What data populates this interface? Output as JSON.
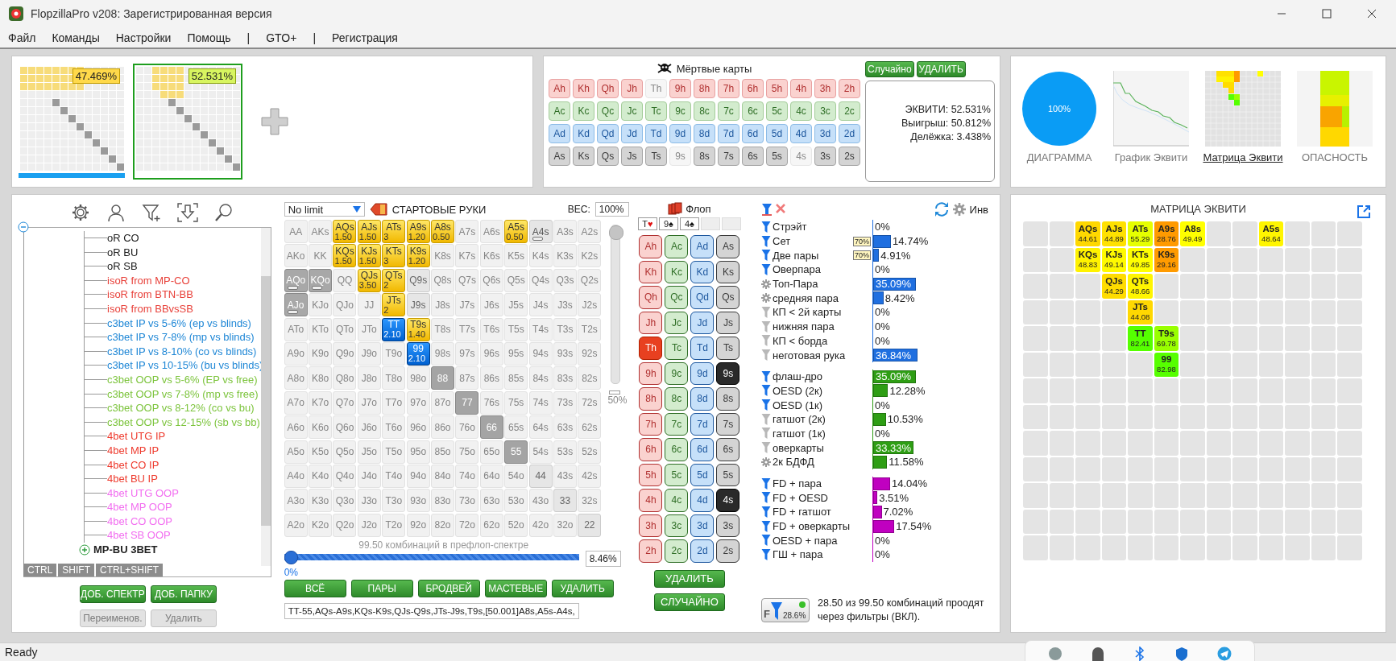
{
  "window": {
    "title": "FlopzillaPro v208: Зарегистрированная версия"
  },
  "menu": [
    "Файл",
    "Команды",
    "Настройки",
    "Помощь",
    "|",
    "GTO+",
    "|",
    "Регистрация"
  ],
  "ranges": [
    {
      "equity": "47.469%",
      "selected": false
    },
    {
      "equity": "52.531%",
      "selected": true
    }
  ],
  "dead_cards": {
    "title": "Мёртвые карты",
    "buttons": [
      "Случайно",
      "УДАЛИТЬ"
    ],
    "rows": [
      {
        "kind": "h",
        "cards": [
          {
            "label": "Ah",
            "used": false
          },
          {
            "label": "Kh",
            "used": false
          },
          {
            "label": "Qh",
            "used": false
          },
          {
            "label": "Jh",
            "used": false
          },
          {
            "label": "Th",
            "used": true
          },
          {
            "label": "9h",
            "used": false
          },
          {
            "label": "8h",
            "used": false
          },
          {
            "label": "7h",
            "used": false
          },
          {
            "label": "6h",
            "used": false
          },
          {
            "label": "5h",
            "used": false
          },
          {
            "label": "4h",
            "used": false
          },
          {
            "label": "3h",
            "used": false
          },
          {
            "label": "2h",
            "used": false
          }
        ]
      },
      {
        "kind": "c",
        "cards": [
          {
            "label": "Ac",
            "used": false
          },
          {
            "label": "Kc",
            "used": false
          },
          {
            "label": "Qc",
            "used": false
          },
          {
            "label": "Jc",
            "used": false
          },
          {
            "label": "Tc",
            "used": false
          },
          {
            "label": "9c",
            "used": false
          },
          {
            "label": "8c",
            "used": false
          },
          {
            "label": "7c",
            "used": false
          },
          {
            "label": "6c",
            "used": false
          },
          {
            "label": "5c",
            "used": false
          },
          {
            "label": "4c",
            "used": false
          },
          {
            "label": "3c",
            "used": false
          },
          {
            "label": "2c",
            "used": false
          }
        ]
      },
      {
        "kind": "d",
        "cards": [
          {
            "label": "Ad",
            "used": false
          },
          {
            "label": "Kd",
            "used": false
          },
          {
            "label": "Qd",
            "used": false
          },
          {
            "label": "Jd",
            "used": false
          },
          {
            "label": "Td",
            "used": false
          },
          {
            "label": "9d",
            "used": false
          },
          {
            "label": "8d",
            "used": false
          },
          {
            "label": "7d",
            "used": false
          },
          {
            "label": "6d",
            "used": false
          },
          {
            "label": "5d",
            "used": false
          },
          {
            "label": "4d",
            "used": false
          },
          {
            "label": "3d",
            "used": false
          },
          {
            "label": "2d",
            "used": false
          }
        ]
      },
      {
        "kind": "s",
        "cards": [
          {
            "label": "As",
            "used": false
          },
          {
            "label": "Ks",
            "used": false
          },
          {
            "label": "Qs",
            "used": false
          },
          {
            "label": "Js",
            "used": false
          },
          {
            "label": "Ts",
            "used": false
          },
          {
            "label": "9s",
            "used": true
          },
          {
            "label": "8s",
            "used": false
          },
          {
            "label": "7s",
            "used": false
          },
          {
            "label": "6s",
            "used": false
          },
          {
            "label": "5s",
            "used": false
          },
          {
            "label": "4s",
            "used": true
          },
          {
            "label": "3s",
            "used": false
          },
          {
            "label": "2s",
            "used": false
          }
        ]
      }
    ],
    "stats": [
      "ЭКВИТИ: 52.531%",
      "Выигрыш: 50.812%",
      "Делёжка: 3.438%"
    ]
  },
  "views": {
    "pie_label": "100%",
    "tabs": [
      {
        "label": "ДИАГРАММА",
        "kind": "pie",
        "selected": false
      },
      {
        "label": "График Эквити",
        "kind": "line",
        "selected": false
      },
      {
        "label": "Матрица Эквити",
        "kind": "matrix",
        "selected": true
      },
      {
        "label": "ОПАСНОСТЬ",
        "kind": "danger",
        "selected": false
      }
    ]
  },
  "tree": {
    "expanded": true,
    "children": [
      {
        "children": [
          {
            "label": "oR CO",
            "color": "#1a1a1a"
          },
          {
            "label": "oR BU",
            "color": "#1a1a1a"
          },
          {
            "label": "oR SB",
            "color": "#1a1a1a"
          },
          {
            "label": "isoR from MP-CO",
            "color": "#e8413a"
          },
          {
            "label": "isoR from BTN-BB",
            "color": "#e8413a"
          },
          {
            "label": "isoR from BBvsSB",
            "color": "#e8413a"
          },
          {
            "label": "c3bet IP vs 5-6% (ep vs blinds)",
            "color": "#1f87d6"
          },
          {
            "label": "c3bet IP vs 7-8% (mp vs blinds)",
            "color": "#1f87d6"
          },
          {
            "label": "c3bet IP vs 8-10% (co vs blinds)",
            "color": "#1f87d6"
          },
          {
            "label": "c3bet IP vs 10-15% (bu vs blinds)",
            "color": "#1f87d6"
          },
          {
            "label": "c3bet OOP vs 5-6% (EP vs free)",
            "color": "#7cc43c"
          },
          {
            "label": "c3bet OOP vs 7-8% (mp vs free)",
            "color": "#7cc43c"
          },
          {
            "label": "c3bet OOP vs 8-12% (co vs bu)",
            "color": "#7cc43c"
          },
          {
            "label": "c3bet OOP vs 12-15% (sb vs bb)",
            "color": "#7cc43c"
          },
          {
            "label": "4bet UTG IP",
            "color": "#ee3b2e"
          },
          {
            "label": "4bet MP IP",
            "color": "#ee3b2e"
          },
          {
            "label": "4bet CO IP",
            "color": "#ee3b2e"
          },
          {
            "label": "4bet BU IP",
            "color": "#ee3b2e"
          },
          {
            "label": "4bet UTG OOP",
            "color": "#f26ef0"
          },
          {
            "label": "4bet MP OOP",
            "color": "#f26ef0"
          },
          {
            "label": "4bet CO OOP",
            "color": "#f26ef0"
          },
          {
            "label": "4bet SB OOP",
            "color": "#f26ef0"
          }
        ]
      },
      {
        "label": "MP-BU 3BET",
        "expanded": false
      }
    ]
  },
  "modifier_keys": [
    "CTRL",
    "SHIFT",
    "CTRL+SHIFT"
  ],
  "tree_buttons": [
    {
      "label": "ДОБ. СПЕКТР",
      "disabled": false
    },
    {
      "label": "ДОБ. ПАПКУ",
      "disabled": false
    },
    {
      "label": "Переименов.",
      "disabled": true
    },
    {
      "label": "Удалить",
      "disabled": true
    }
  ],
  "game": "No limit",
  "hands_title": "СТАРТОВЫЕ РУКИ",
  "weight_label": "ВЕС:",
  "weight_value": "100%",
  "weight_slider": {
    "level": 1,
    "label": "50%"
  },
  "hand_matrix": [
    [
      {
        "label": "AA",
        "kind": "off"
      },
      {
        "label": "AKs",
        "kind": "off"
      },
      {
        "label": "AQs",
        "kind": "on",
        "weight": "1.50"
      },
      {
        "label": "AJs",
        "kind": "on",
        "weight": "1.50"
      },
      {
        "label": "ATs",
        "kind": "on",
        "weight": "3"
      },
      {
        "label": "A9s",
        "kind": "on",
        "weight": "1.20"
      },
      {
        "label": "A8s",
        "kind": "on",
        "weight": "0.50"
      },
      {
        "label": "A7s",
        "kind": "off"
      },
      {
        "label": "A6s",
        "kind": "off"
      },
      {
        "label": "A5s",
        "kind": "on",
        "weight": "0.50"
      },
      {
        "label": "A4s",
        "kind": "palepart"
      },
      {
        "label": "A3s",
        "kind": "off"
      },
      {
        "label": "A2s",
        "kind": "off"
      }
    ],
    [
      {
        "label": "AKo",
        "kind": "off"
      },
      {
        "label": "KK",
        "kind": "off"
      },
      {
        "label": "KQs",
        "kind": "on",
        "weight": "1.50"
      },
      {
        "label": "KJs",
        "kind": "on",
        "weight": "1.50"
      },
      {
        "label": "KTs",
        "kind": "on",
        "weight": "3"
      },
      {
        "label": "K9s",
        "kind": "on",
        "weight": "1.20"
      },
      {
        "label": "K8s",
        "kind": "off"
      },
      {
        "label": "K7s",
        "kind": "off"
      },
      {
        "label": "K6s",
        "kind": "off"
      },
      {
        "label": "K5s",
        "kind": "off"
      },
      {
        "label": "K4s",
        "kind": "off"
      },
      {
        "label": "K3s",
        "kind": "off"
      },
      {
        "label": "K2s",
        "kind": "off"
      }
    ],
    [
      {
        "label": "AQo",
        "kind": "part"
      },
      {
        "label": "KQo",
        "kind": "part"
      },
      {
        "label": "QQ",
        "kind": "off"
      },
      {
        "label": "QJs",
        "kind": "on",
        "weight": "3.50"
      },
      {
        "label": "QTs",
        "kind": "on",
        "weight": "2"
      },
      {
        "label": "Q9s",
        "kind": "pale"
      },
      {
        "label": "Q8s",
        "kind": "off"
      },
      {
        "label": "Q7s",
        "kind": "off"
      },
      {
        "label": "Q6s",
        "kind": "off"
      },
      {
        "label": "Q5s",
        "kind": "off"
      },
      {
        "label": "Q4s",
        "kind": "off"
      },
      {
        "label": "Q3s",
        "kind": "off"
      },
      {
        "label": "Q2s",
        "kind": "off"
      }
    ],
    [
      {
        "label": "AJo",
        "kind": "part"
      },
      {
        "label": "KJo",
        "kind": "off"
      },
      {
        "label": "QJo",
        "kind": "off"
      },
      {
        "label": "JJ",
        "kind": "off"
      },
      {
        "label": "JTs",
        "kind": "on",
        "weight": "2"
      },
      {
        "label": "J9s",
        "kind": "pale"
      },
      {
        "label": "J8s",
        "kind": "off"
      },
      {
        "label": "J7s",
        "kind": "off"
      },
      {
        "label": "J6s",
        "kind": "off"
      },
      {
        "label": "J5s",
        "kind": "off"
      },
      {
        "label": "J4s",
        "kind": "off"
      },
      {
        "label": "J3s",
        "kind": "off"
      },
      {
        "label": "J2s",
        "kind": "off"
      }
    ],
    [
      {
        "label": "ATo",
        "kind": "off"
      },
      {
        "label": "KTo",
        "kind": "off"
      },
      {
        "label": "QTo",
        "kind": "off"
      },
      {
        "label": "JTo",
        "kind": "off"
      },
      {
        "label": "TT",
        "kind": "blue",
        "weight": "2.10"
      },
      {
        "label": "T9s",
        "kind": "on",
        "weight": "1.40"
      },
      {
        "label": "T8s",
        "kind": "off"
      },
      {
        "label": "T7s",
        "kind": "off"
      },
      {
        "label": "T6s",
        "kind": "off"
      },
      {
        "label": "T5s",
        "kind": "off"
      },
      {
        "label": "T4s",
        "kind": "off"
      },
      {
        "label": "T3s",
        "kind": "off"
      },
      {
        "label": "T2s",
        "kind": "off"
      }
    ],
    [
      {
        "label": "A9o",
        "kind": "off"
      },
      {
        "label": "K9o",
        "kind": "off"
      },
      {
        "label": "Q9o",
        "kind": "off"
      },
      {
        "label": "J9o",
        "kind": "off"
      },
      {
        "label": "T9o",
        "kind": "off"
      },
      {
        "label": "99",
        "kind": "blue",
        "weight": "2.10"
      },
      {
        "label": "98s",
        "kind": "off"
      },
      {
        "label": "97s",
        "kind": "off"
      },
      {
        "label": "96s",
        "kind": "off"
      },
      {
        "label": "95s",
        "kind": "off"
      },
      {
        "label": "94s",
        "kind": "off"
      },
      {
        "label": "93s",
        "kind": "off"
      },
      {
        "label": "92s",
        "kind": "off"
      }
    ],
    [
      {
        "label": "A8o",
        "kind": "off"
      },
      {
        "label": "K8o",
        "kind": "off"
      },
      {
        "label": "Q8o",
        "kind": "off"
      },
      {
        "label": "J8o",
        "kind": "off"
      },
      {
        "label": "T8o",
        "kind": "off"
      },
      {
        "label": "98o",
        "kind": "off"
      },
      {
        "label": "88",
        "kind": "grey"
      },
      {
        "label": "87s",
        "kind": "off"
      },
      {
        "label": "86s",
        "kind": "off"
      },
      {
        "label": "85s",
        "kind": "off"
      },
      {
        "label": "84s",
        "kind": "off"
      },
      {
        "label": "83s",
        "kind": "off"
      },
      {
        "label": "82s",
        "kind": "off"
      }
    ],
    [
      {
        "label": "A7o",
        "kind": "off"
      },
      {
        "label": "K7o",
        "kind": "off"
      },
      {
        "label": "Q7o",
        "kind": "off"
      },
      {
        "label": "J7o",
        "kind": "off"
      },
      {
        "label": "T7o",
        "kind": "off"
      },
      {
        "label": "97o",
        "kind": "off"
      },
      {
        "label": "87o",
        "kind": "off"
      },
      {
        "label": "77",
        "kind": "grey"
      },
      {
        "label": "76s",
        "kind": "off"
      },
      {
        "label": "75s",
        "kind": "off"
      },
      {
        "label": "74s",
        "kind": "off"
      },
      {
        "label": "73s",
        "kind": "off"
      },
      {
        "label": "72s",
        "kind": "off"
      }
    ],
    [
      {
        "label": "A6o",
        "kind": "off"
      },
      {
        "label": "K6o",
        "kind": "off"
      },
      {
        "label": "Q6o",
        "kind": "off"
      },
      {
        "label": "J6o",
        "kind": "off"
      },
      {
        "label": "T6o",
        "kind": "off"
      },
      {
        "label": "96o",
        "kind": "off"
      },
      {
        "label": "86o",
        "kind": "off"
      },
      {
        "label": "76o",
        "kind": "off"
      },
      {
        "label": "66",
        "kind": "grey"
      },
      {
        "label": "65s",
        "kind": "off"
      },
      {
        "label": "64s",
        "kind": "off"
      },
      {
        "label": "63s",
        "kind": "off"
      },
      {
        "label": "62s",
        "kind": "off"
      }
    ],
    [
      {
        "label": "A5o",
        "kind": "off"
      },
      {
        "label": "K5o",
        "kind": "off"
      },
      {
        "label": "Q5o",
        "kind": "off"
      },
      {
        "label": "J5o",
        "kind": "off"
      },
      {
        "label": "T5o",
        "kind": "off"
      },
      {
        "label": "95o",
        "kind": "off"
      },
      {
        "label": "85o",
        "kind": "off"
      },
      {
        "label": "75o",
        "kind": "off"
      },
      {
        "label": "65o",
        "kind": "off"
      },
      {
        "label": "55",
        "kind": "grey"
      },
      {
        "label": "54s",
        "kind": "off"
      },
      {
        "label": "53s",
        "kind": "off"
      },
      {
        "label": "52s",
        "kind": "off"
      }
    ],
    [
      {
        "label": "A4o",
        "kind": "off"
      },
      {
        "label": "K4o",
        "kind": "off"
      },
      {
        "label": "Q4o",
        "kind": "off"
      },
      {
        "label": "J4o",
        "kind": "off"
      },
      {
        "label": "T4o",
        "kind": "off"
      },
      {
        "label": "94o",
        "kind": "off"
      },
      {
        "label": "84o",
        "kind": "off"
      },
      {
        "label": "74o",
        "kind": "off"
      },
      {
        "label": "64o",
        "kind": "off"
      },
      {
        "label": "54o",
        "kind": "off"
      },
      {
        "label": "44",
        "kind": "pale"
      },
      {
        "label": "43s",
        "kind": "off"
      },
      {
        "label": "42s",
        "kind": "off"
      }
    ],
    [
      {
        "label": "A3o",
        "kind": "off"
      },
      {
        "label": "K3o",
        "kind": "off"
      },
      {
        "label": "Q3o",
        "kind": "off"
      },
      {
        "label": "J3o",
        "kind": "off"
      },
      {
        "label": "T3o",
        "kind": "off"
      },
      {
        "label": "93o",
        "kind": "off"
      },
      {
        "label": "83o",
        "kind": "off"
      },
      {
        "label": "73o",
        "kind": "off"
      },
      {
        "label": "63o",
        "kind": "off"
      },
      {
        "label": "53o",
        "kind": "off"
      },
      {
        "label": "43o",
        "kind": "off"
      },
      {
        "label": "33",
        "kind": "pale"
      },
      {
        "label": "32s",
        "kind": "off"
      }
    ],
    [
      {
        "label": "A2o",
        "kind": "off"
      },
      {
        "label": "K2o",
        "kind": "off"
      },
      {
        "label": "Q2o",
        "kind": "off"
      },
      {
        "label": "J2o",
        "kind": "off"
      },
      {
        "label": "T2o",
        "kind": "off"
      },
      {
        "label": "92o",
        "kind": "off"
      },
      {
        "label": "82o",
        "kind": "off"
      },
      {
        "label": "72o",
        "kind": "off"
      },
      {
        "label": "62o",
        "kind": "off"
      },
      {
        "label": "52o",
        "kind": "off"
      },
      {
        "label": "42o",
        "kind": "off"
      },
      {
        "label": "32o",
        "kind": "off"
      },
      {
        "label": "22",
        "kind": "pale"
      }
    ]
  ],
  "combos_caption": "99.50 комбинаций в префлоп-спектре",
  "range_slider": {
    "level": 0,
    "min_label": "0%",
    "value": "8.46%"
  },
  "hand_buttons": [
    "ВСЁ",
    "ПАРЫ",
    "БРОДВЕЙ",
    "МАСТЕВЫЕ",
    "УДАЛИТЬ"
  ],
  "range_text": "TT-55,AQs-A9s,KQs-K9s,QJs-Q9s,JTs-J9s,T9s,[50.001]A8s,A5s-A4s,",
  "flop": {
    "title": "Флоп",
    "board": [
      {
        "rank": "T",
        "suit": "♥",
        "kind": "red"
      },
      {
        "rank": "9",
        "suit": "♠",
        "kind": "black"
      },
      {
        "rank": "4",
        "suit": "♠",
        "kind": "black"
      }
    ],
    "columns": [
      {
        "kind": "h",
        "cards": [
          {
            "label": "Ah",
            "selected": false
          },
          {
            "label": "Kh",
            "selected": false
          },
          {
            "label": "Qh",
            "selected": false
          },
          {
            "label": "Jh",
            "selected": false
          },
          {
            "label": "Th",
            "selected": true
          },
          {
            "label": "9h",
            "selected": false
          },
          {
            "label": "8h",
            "selected": false
          },
          {
            "label": "7h",
            "selected": false
          },
          {
            "label": "6h",
            "selected": false
          },
          {
            "label": "5h",
            "selected": false
          },
          {
            "label": "4h",
            "selected": false
          },
          {
            "label": "3h",
            "selected": false
          },
          {
            "label": "2h",
            "selected": false
          }
        ]
      },
      {
        "kind": "c",
        "cards": [
          {
            "label": "Ac",
            "selected": false
          },
          {
            "label": "Kc",
            "selected": false
          },
          {
            "label": "Qc",
            "selected": false
          },
          {
            "label": "Jc",
            "selected": false
          },
          {
            "label": "Tc",
            "selected": false
          },
          {
            "label": "9c",
            "selected": false
          },
          {
            "label": "8c",
            "selected": false
          },
          {
            "label": "7c",
            "selected": false
          },
          {
            "label": "6c",
            "selected": false
          },
          {
            "label": "5c",
            "selected": false
          },
          {
            "label": "4c",
            "selected": false
          },
          {
            "label": "3c",
            "selected": false
          },
          {
            "label": "2c",
            "selected": false
          }
        ]
      },
      {
        "kind": "d",
        "cards": [
          {
            "label": "Ad",
            "selected": false
          },
          {
            "label": "Kd",
            "selected": false
          },
          {
            "label": "Qd",
            "selected": false
          },
          {
            "label": "Jd",
            "selected": false
          },
          {
            "label": "Td",
            "selected": false
          },
          {
            "label": "9d",
            "selected": false
          },
          {
            "label": "8d",
            "selected": false
          },
          {
            "label": "7d",
            "selected": false
          },
          {
            "label": "6d",
            "selected": false
          },
          {
            "label": "5d",
            "selected": false
          },
          {
            "label": "4d",
            "selected": false
          },
          {
            "label": "3d",
            "selected": false
          },
          {
            "label": "2d",
            "selected": false
          }
        ]
      },
      {
        "kind": "s",
        "cards": [
          {
            "label": "As",
            "selected": false
          },
          {
            "label": "Ks",
            "selected": false
          },
          {
            "label": "Qs",
            "selected": false
          },
          {
            "label": "Js",
            "selected": false
          },
          {
            "label": "Ts",
            "selected": false
          },
          {
            "label": "9s",
            "selected": true
          },
          {
            "label": "8s",
            "selected": false
          },
          {
            "label": "7s",
            "selected": false
          },
          {
            "label": "6s",
            "selected": false
          },
          {
            "label": "5s",
            "selected": false
          },
          {
            "label": "4s",
            "selected": true
          },
          {
            "label": "3s",
            "selected": false
          },
          {
            "label": "2s",
            "selected": false
          }
        ]
      }
    ],
    "buttons": [
      "УДАЛИТЬ",
      "СЛУЧАЙНО"
    ]
  },
  "filters": {
    "invert_label": "Инв",
    "groups": [
      {
        "color": "#1f6fe0",
        "items": [
          {
            "label": "Стрэйт",
            "kind": "filter",
            "level": 0,
            "value": "0%"
          },
          {
            "label": "Сет",
            "kind": "filter",
            "level": 0.1474,
            "value": "14.74%",
            "badge": "70%"
          },
          {
            "label": "Две пары",
            "kind": "filter",
            "level": 0.0491,
            "value": "4.91%",
            "badge": "70%"
          },
          {
            "label": "Оверпара",
            "kind": "filter",
            "level": 0,
            "value": "0%"
          },
          {
            "label": "Топ-Пара",
            "kind": "gear",
            "level": 0.3509,
            "value": "35.09%"
          },
          {
            "label": "средняя пара",
            "kind": "gear",
            "level": 0.0842,
            "value": "8.42%"
          },
          {
            "label": "КП < 2й карты",
            "kind": "off",
            "level": 0,
            "value": "0%"
          },
          {
            "label": "нижняя пара",
            "kind": "off",
            "level": 0,
            "value": "0%"
          },
          {
            "label": "КП < борда",
            "kind": "off",
            "level": 0,
            "value": "0%"
          },
          {
            "label": "неготовая рука",
            "kind": "off",
            "level": 0.3684,
            "value": "36.84%"
          }
        ]
      },
      {
        "color": "#2e9e14",
        "items": [
          {
            "label": "флаш-дро",
            "kind": "filter",
            "level": 0.3509,
            "value": "35.09%"
          },
          {
            "label": "OESD (2к)",
            "kind": "filter",
            "level": 0.1228,
            "value": "12.28%"
          },
          {
            "label": "OESD (1к)",
            "kind": "filter",
            "level": 0,
            "value": "0%"
          },
          {
            "label": "гатшот (2к)",
            "kind": "off",
            "level": 0.1053,
            "value": "10.53%"
          },
          {
            "label": "гатшот (1к)",
            "kind": "off",
            "level": 0,
            "value": "0%"
          },
          {
            "label": "оверкарты",
            "kind": "off",
            "level": 0.3333,
            "value": "33.33%"
          },
          {
            "label": "2к БДФД",
            "kind": "gear",
            "level": 0.1158,
            "value": "11.58%"
          }
        ]
      },
      {
        "color": "#c000c0",
        "items": [
          {
            "label": "FD + пара",
            "kind": "filter",
            "level": 0.1404,
            "value": "14.04%"
          },
          {
            "label": "FD + OESD",
            "kind": "filter",
            "level": 0.0351,
            "value": "3.51%"
          },
          {
            "label": "FD + гатшот",
            "kind": "filter",
            "level": 0.0702,
            "value": "7.02%"
          },
          {
            "label": "FD + оверкарты",
            "kind": "filter",
            "level": 0.1754,
            "value": "17.54%"
          },
          {
            "label": "OESD + пара",
            "kind": "filter",
            "level": 0,
            "value": "0%"
          },
          {
            "label": "ГШ + пара",
            "kind": "filter",
            "level": 0,
            "value": "0%"
          }
        ]
      }
    ],
    "summary_button": {
      "letter": "F",
      "value": "28.6%"
    },
    "summary": "28.50 из 99.50 комбинаций проодят через фильтры (ВКЛ)."
  },
  "equity_matrix": {
    "title": "МАТРИЦА ЭКВИТИ",
    "rows": [
      [
        {
          "kind": "empty"
        },
        {
          "kind": "empty"
        },
        {
          "kind": "hand",
          "label": "AQs",
          "value": "44.61",
          "color": "#ffd800"
        },
        {
          "kind": "hand",
          "label": "AJs",
          "value": "44.89",
          "color": "#ffe100"
        },
        {
          "kind": "hand",
          "label": "ATs",
          "value": "55.29",
          "color": "#e6ff00"
        },
        {
          "kind": "hand",
          "label": "A9s",
          "value": "28.76",
          "color": "#ff9a00"
        },
        {
          "kind": "hand",
          "label": "A8s",
          "value": "49.49",
          "color": "#ffff00"
        },
        {
          "kind": "empty"
        },
        {
          "kind": "empty"
        },
        {
          "kind": "hand",
          "label": "A5s",
          "value": "48.64",
          "color": "#fff500"
        },
        {
          "kind": "empty"
        },
        {
          "kind": "empty"
        },
        {
          "kind": "empty"
        }
      ],
      [
        {
          "kind": "empty"
        },
        {
          "kind": "empty"
        },
        {
          "kind": "hand",
          "label": "KQs",
          "value": "48.83",
          "color": "#fff200"
        },
        {
          "kind": "hand",
          "label": "KJs",
          "value": "49.14",
          "color": "#fffa00"
        },
        {
          "kind": "hand",
          "label": "KTs",
          "value": "49.85",
          "color": "#ffff01"
        },
        {
          "kind": "hand",
          "label": "K9s",
          "value": "29.16",
          "color": "#ff9b00"
        },
        {
          "kind": "empty"
        },
        {
          "kind": "empty"
        },
        {
          "kind": "empty"
        },
        {
          "kind": "empty"
        },
        {
          "kind": "empty"
        },
        {
          "kind": "empty"
        },
        {
          "kind": "empty"
        }
      ],
      [
        {
          "kind": "empty"
        },
        {
          "kind": "empty"
        },
        {
          "kind": "empty"
        },
        {
          "kind": "hand",
          "label": "QJs",
          "value": "44.29",
          "color": "#ffdc00"
        },
        {
          "kind": "hand",
          "label": "QTs",
          "value": "48.66",
          "color": "#fff501"
        },
        {
          "kind": "empty"
        },
        {
          "kind": "empty"
        },
        {
          "kind": "empty"
        },
        {
          "kind": "empty"
        },
        {
          "kind": "empty"
        },
        {
          "kind": "empty"
        },
        {
          "kind": "empty"
        },
        {
          "kind": "empty"
        }
      ],
      [
        {
          "kind": "empty"
        },
        {
          "kind": "empty"
        },
        {
          "kind": "empty"
        },
        {
          "kind": "empty"
        },
        {
          "kind": "hand",
          "label": "JTs",
          "value": "44.08",
          "color": "#ffd801"
        },
        {
          "kind": "empty"
        },
        {
          "kind": "empty"
        },
        {
          "kind": "empty"
        },
        {
          "kind": "empty"
        },
        {
          "kind": "empty"
        },
        {
          "kind": "empty"
        },
        {
          "kind": "empty"
        },
        {
          "kind": "empty"
        }
      ],
      [
        {
          "kind": "empty"
        },
        {
          "kind": "empty"
        },
        {
          "kind": "empty"
        },
        {
          "kind": "empty"
        },
        {
          "kind": "hand",
          "label": "TT",
          "value": "82.41",
          "color": "#55ff00"
        },
        {
          "kind": "hand",
          "label": "T9s",
          "value": "69.78",
          "color": "#99ff00"
        },
        {
          "kind": "empty"
        },
        {
          "kind": "empty"
        },
        {
          "kind": "empty"
        },
        {
          "kind": "empty"
        },
        {
          "kind": "empty"
        },
        {
          "kind": "empty"
        },
        {
          "kind": "empty"
        }
      ],
      [
        {
          "kind": "empty"
        },
        {
          "kind": "empty"
        },
        {
          "kind": "empty"
        },
        {
          "kind": "empty"
        },
        {
          "kind": "empty"
        },
        {
          "kind": "hand",
          "label": "99",
          "value": "82.98",
          "color": "#56ff00"
        },
        {
          "kind": "empty"
        },
        {
          "kind": "empty"
        },
        {
          "kind": "empty"
        },
        {
          "kind": "empty"
        },
        {
          "kind": "empty"
        },
        {
          "kind": "empty"
        },
        {
          "kind": "empty"
        }
      ],
      [
        {
          "kind": "empty"
        },
        {
          "kind": "empty"
        },
        {
          "kind": "empty"
        },
        {
          "kind": "empty"
        },
        {
          "kind": "empty"
        },
        {
          "kind": "empty"
        },
        {
          "kind": "empty"
        },
        {
          "kind": "empty"
        },
        {
          "kind": "empty"
        },
        {
          "kind": "empty"
        },
        {
          "kind": "empty"
        },
        {
          "kind": "empty"
        },
        {
          "kind": "empty"
        }
      ],
      [
        {
          "kind": "empty"
        },
        {
          "kind": "empty"
        },
        {
          "kind": "empty"
        },
        {
          "kind": "empty"
        },
        {
          "kind": "empty"
        },
        {
          "kind": "empty"
        },
        {
          "kind": "empty"
        },
        {
          "kind": "empty"
        },
        {
          "kind": "empty"
        },
        {
          "kind": "empty"
        },
        {
          "kind": "empty"
        },
        {
          "kind": "empty"
        },
        {
          "kind": "empty"
        }
      ],
      [
        {
          "kind": "empty"
        },
        {
          "kind": "empty"
        },
        {
          "kind": "empty"
        },
        {
          "kind": "empty"
        },
        {
          "kind": "empty"
        },
        {
          "kind": "empty"
        },
        {
          "kind": "empty"
        },
        {
          "kind": "empty"
        },
        {
          "kind": "empty"
        },
        {
          "kind": "empty"
        },
        {
          "kind": "empty"
        },
        {
          "kind": "empty"
        },
        {
          "kind": "empty"
        }
      ],
      [
        {
          "kind": "empty"
        },
        {
          "kind": "empty"
        },
        {
          "kind": "empty"
        },
        {
          "kind": "empty"
        },
        {
          "kind": "empty"
        },
        {
          "kind": "empty"
        },
        {
          "kind": "empty"
        },
        {
          "kind": "empty"
        },
        {
          "kind": "empty"
        },
        {
          "kind": "empty"
        },
        {
          "kind": "empty"
        },
        {
          "kind": "empty"
        },
        {
          "kind": "empty"
        }
      ],
      [
        {
          "kind": "empty"
        },
        {
          "kind": "empty"
        },
        {
          "kind": "empty"
        },
        {
          "kind": "empty"
        },
        {
          "kind": "empty"
        },
        {
          "kind": "empty"
        },
        {
          "kind": "empty"
        },
        {
          "kind": "empty"
        },
        {
          "kind": "empty"
        },
        {
          "kind": "empty"
        },
        {
          "kind": "empty"
        },
        {
          "kind": "empty"
        },
        {
          "kind": "empty"
        }
      ],
      [
        {
          "kind": "empty"
        },
        {
          "kind": "empty"
        },
        {
          "kind": "empty"
        },
        {
          "kind": "empty"
        },
        {
          "kind": "empty"
        },
        {
          "kind": "empty"
        },
        {
          "kind": "empty"
        },
        {
          "kind": "empty"
        },
        {
          "kind": "empty"
        },
        {
          "kind": "empty"
        },
        {
          "kind": "empty"
        },
        {
          "kind": "empty"
        },
        {
          "kind": "empty"
        }
      ],
      [
        {
          "kind": "empty"
        },
        {
          "kind": "empty"
        },
        {
          "kind": "empty"
        },
        {
          "kind": "empty"
        },
        {
          "kind": "empty"
        },
        {
          "kind": "empty"
        },
        {
          "kind": "empty"
        },
        {
          "kind": "empty"
        },
        {
          "kind": "empty"
        },
        {
          "kind": "empty"
        },
        {
          "kind": "empty"
        },
        {
          "kind": "empty"
        },
        {
          "kind": "empty"
        }
      ]
    ]
  },
  "status_bar": "Ready"
}
